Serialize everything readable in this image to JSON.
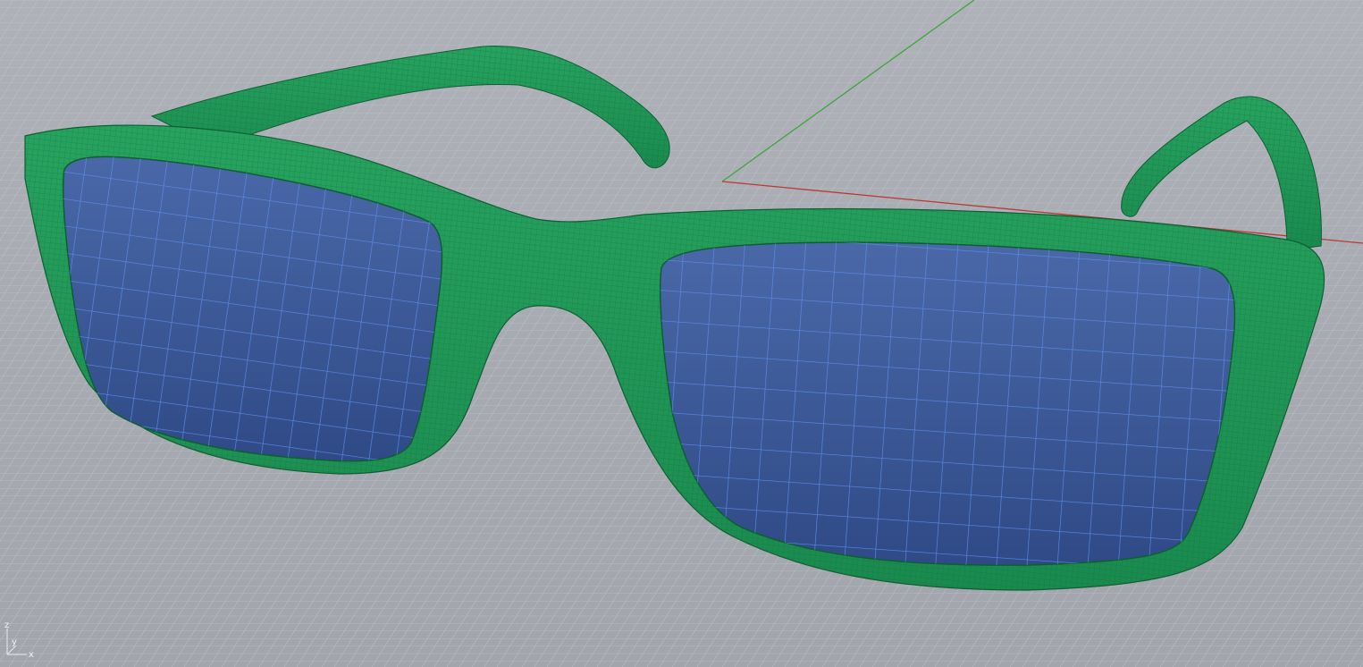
{
  "viewport": {
    "background_color": "#a8acb2",
    "grid_minor_color": "#c3c6ca",
    "grid_major_color": "#b8bbbf",
    "x_axis_color": "#b83a32",
    "y_axis_color": "#3da63a"
  },
  "model": {
    "object": "eyeglasses",
    "frame_color": "#1f9657",
    "frame_wire_color": "#0f5e33",
    "lens_color": "#3d5b9c",
    "lens_wire_color": "#5b8ef0"
  },
  "axis_widget": {
    "z_label": "z",
    "y_label": "y",
    "x_label": "x"
  }
}
